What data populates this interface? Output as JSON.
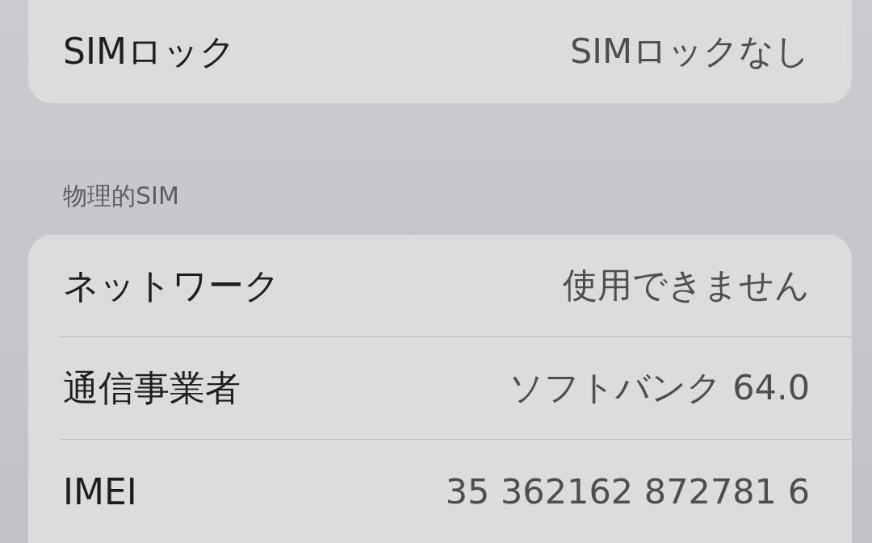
{
  "groups": [
    {
      "rows": [
        {
          "label": "SIMロック",
          "value": "SIMロックなし"
        }
      ]
    },
    {
      "header": "物理的SIM",
      "rows": [
        {
          "label": "ネットワーク",
          "value": "使用できません"
        },
        {
          "label": "通信事業者",
          "value": "ソフトバンク 64.0"
        },
        {
          "label": "IMEI",
          "value": "35 362162 872781 6"
        }
      ]
    }
  ]
}
